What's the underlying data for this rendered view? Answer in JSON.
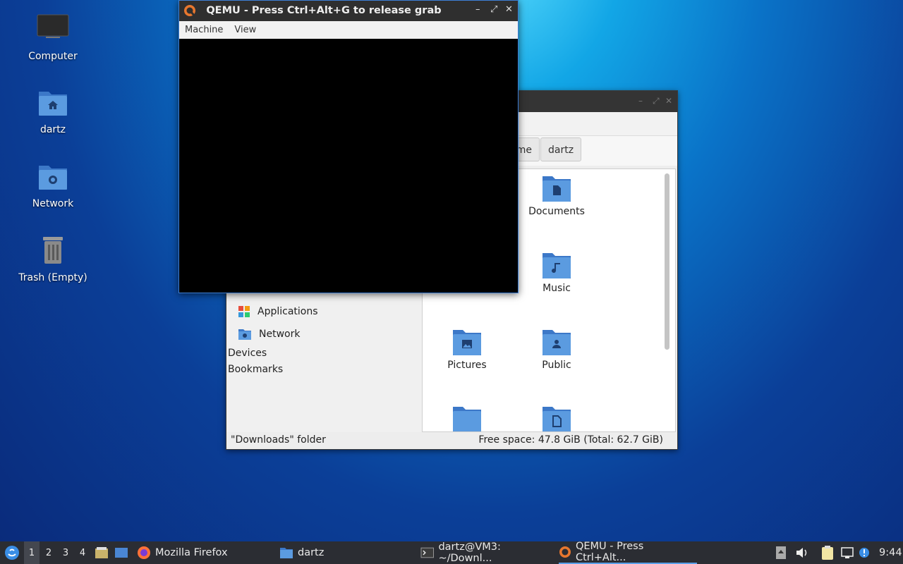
{
  "desktop": {
    "icons": [
      {
        "label": "Computer"
      },
      {
        "label": "dartz"
      },
      {
        "label": "Network"
      },
      {
        "label": "Trash (Empty)"
      }
    ]
  },
  "qemu": {
    "title": "QEMU - Press Ctrl+Alt+G to release grab",
    "menu": {
      "machine": "Machine",
      "view": "View"
    },
    "controls": {
      "minimize": "–",
      "restore": "⤢",
      "close": "✕"
    }
  },
  "file_manager": {
    "path": {
      "partial": "me",
      "current": "dartz"
    },
    "sidebar": {
      "items": [
        {
          "label": "Applications"
        },
        {
          "label": "Network"
        }
      ],
      "headers": {
        "devices": "Devices",
        "bookmarks": "Bookmarks"
      }
    },
    "folders": [
      {
        "label": "Documents"
      },
      {
        "label": "Music"
      },
      {
        "label": "Pictures"
      },
      {
        "label": "Public"
      }
    ],
    "status": {
      "left": "\"Downloads\" folder",
      "right": "Free space: 47.8 GiB (Total: 62.7 GiB)"
    }
  },
  "taskbar": {
    "workspaces": [
      "1",
      "2",
      "3",
      "4"
    ],
    "tasks": [
      {
        "label": "Mozilla Firefox"
      },
      {
        "label": "dartz"
      },
      {
        "label": "dartz@VM3: ~/Downl..."
      },
      {
        "label": "QEMU - Press Ctrl+Alt..."
      }
    ],
    "clock": "9:44"
  },
  "colors": {
    "folder": "#4a86d4",
    "accent": "#5aa0e8",
    "taskbar": "#2b2d33"
  }
}
